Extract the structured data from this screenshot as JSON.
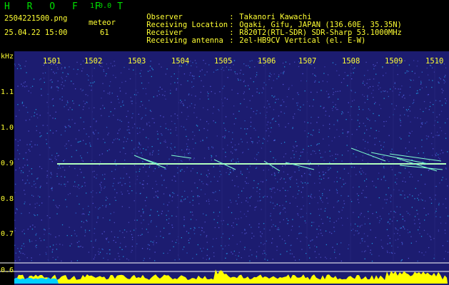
{
  "app": {
    "name": "H R O F F T",
    "version": "1.0.0"
  },
  "file": {
    "name": "2504221500.png",
    "datetime": "25.04.22 15:00"
  },
  "meteor": {
    "label": "meteor",
    "count": "61"
  },
  "info": [
    {
      "label": "Observer",
      "value": "Takanori Kawachi"
    },
    {
      "label": "Receiving Location",
      "value": "Ogaki, Gifu, JAPAN (136.60E, 35.35N)"
    },
    {
      "label": "Receiver",
      "value": "R820T2(RTL-SDR) SDR-Sharp 53.1000MHz"
    },
    {
      "label": "Receiving antenna",
      "value": "2el-HB9CV Vertical (el. E-W)"
    }
  ],
  "axis": {
    "yunit": "kHz",
    "xticks": [
      "1501",
      "1502",
      "1503",
      "1504",
      "1505",
      "1506",
      "1507",
      "1508",
      "1509",
      "1510"
    ],
    "yticks": [
      "1.1",
      "1.0",
      "0.9",
      "0.8",
      "0.7",
      "0.6"
    ]
  },
  "colors": {
    "text": "#ffff33",
    "title": "#00e000",
    "background": "#000000",
    "spectrum": "#1c1c70",
    "trace": "#ffff00"
  }
}
